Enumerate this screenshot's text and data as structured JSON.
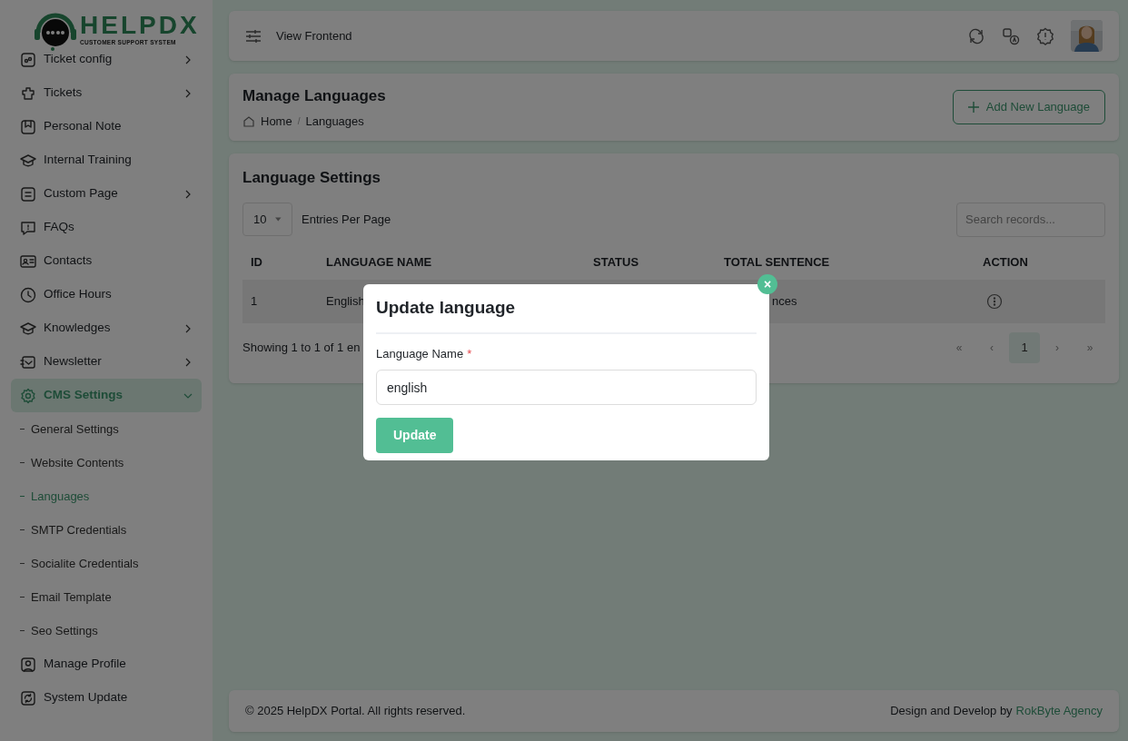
{
  "logo": {
    "name": "HELPDX",
    "tagline": "CUSTOMER SUPPORT SYSTEM"
  },
  "sidebar": {
    "items": [
      {
        "label": "Ticket config",
        "submenu": true,
        "expanded": false,
        "selected": false
      },
      {
        "label": "Tickets",
        "submenu": true,
        "expanded": false,
        "selected": false
      },
      {
        "label": "Personal Note",
        "selected": false
      },
      {
        "label": "Internal Training",
        "selected": false
      },
      {
        "label": "Custom Page",
        "submenu": true,
        "expanded": false,
        "selected": false
      },
      {
        "label": "FAQs",
        "selected": false
      },
      {
        "label": "Contacts",
        "selected": false
      },
      {
        "label": "Office Hours",
        "selected": false
      },
      {
        "label": "Knowledges",
        "submenu": true,
        "expanded": false,
        "selected": false
      },
      {
        "label": "Newsletter",
        "submenu": true,
        "expanded": false,
        "selected": false
      },
      {
        "label": "CMS Settings",
        "submenu": true,
        "expanded": true,
        "selected": true,
        "children": [
          {
            "label": "General Settings",
            "selected": false
          },
          {
            "label": "Website Contents",
            "selected": false
          },
          {
            "label": "Languages",
            "selected": true
          },
          {
            "label": "SMTP Credentials",
            "selected": false
          },
          {
            "label": "Socialite Credentials",
            "selected": false
          },
          {
            "label": "Email Template",
            "selected": false
          },
          {
            "label": "Seo Settings",
            "selected": false
          }
        ]
      },
      {
        "label": "Manage Profile",
        "selected": false
      },
      {
        "label": "System Update",
        "selected": false
      }
    ]
  },
  "topbar": {
    "link": "View Frontend"
  },
  "page_header": {
    "title": "Manage Languages",
    "breadcrumb": [
      "Home",
      "Languages"
    ],
    "breadcrumb_separator": "/",
    "add_button": "Add New Language"
  },
  "table_card": {
    "title": "Language Settings",
    "page_size": "10",
    "page_size_label": "Entries Per Page",
    "search": {
      "placeholder": "Search records..."
    },
    "columns": [
      "ID",
      "LANGUAGE NAME",
      "STATUS",
      "TOTAL SENTENCE",
      "ACTION"
    ],
    "rows": [
      {
        "id": "1",
        "language_name": "English",
        "total_sentence": "nces"
      }
    ],
    "summary": "Showing 1 to 1 of 1 en",
    "pagination": [
      {
        "label": "«",
        "selected": false
      },
      {
        "label": "‹",
        "selected": false
      },
      {
        "label": "1",
        "selected": true
      },
      {
        "label": "›",
        "selected": false
      },
      {
        "label": "»",
        "selected": false
      }
    ]
  },
  "modal": {
    "title": "Update language",
    "field": {
      "label": "Language Name",
      "required_mark": "*",
      "value": "english"
    },
    "button": "Update",
    "close": "×"
  },
  "footer": {
    "copyright": "© 2025 HelpDX Portal. All rights reserved.",
    "credit": "Design and Develop by",
    "credit_link": "RokByte Agency"
  }
}
